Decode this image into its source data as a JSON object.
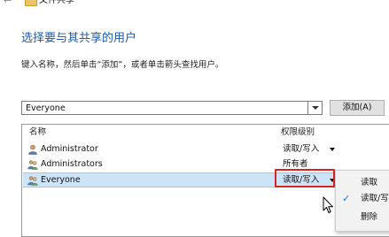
{
  "window": {
    "title": "文件共享"
  },
  "heading": "选择要与其共享的用户",
  "instruction": "键入名称，然后单击“添加”，或者单击箭头查找用户。",
  "user_input": {
    "value": "Everyone"
  },
  "add_button": "添加(A)",
  "list": {
    "columns": {
      "name": "名称",
      "permission": "权限级别"
    },
    "rows": [
      {
        "name": "Administrator",
        "permission": "读取/写入",
        "icon": "single-user-icon",
        "has_dropdown": true
      },
      {
        "name": "Administrators",
        "permission": "所有者",
        "icon": "user-group-icon",
        "has_dropdown": false
      },
      {
        "name": "Everyone",
        "permission": "读取/写入",
        "icon": "user-group-icon",
        "has_dropdown": true,
        "selected": true
      }
    ]
  },
  "permission_menu": {
    "items": [
      {
        "label": "读取",
        "checked": false
      },
      {
        "label": "读取/写",
        "checked": true
      },
      {
        "label": "删除",
        "checked": false
      }
    ]
  },
  "colors": {
    "heading": "#1c5aa6",
    "selection": "#cce4f7",
    "highlight_box": "#d92424",
    "checkmark": "#1a73d9"
  }
}
